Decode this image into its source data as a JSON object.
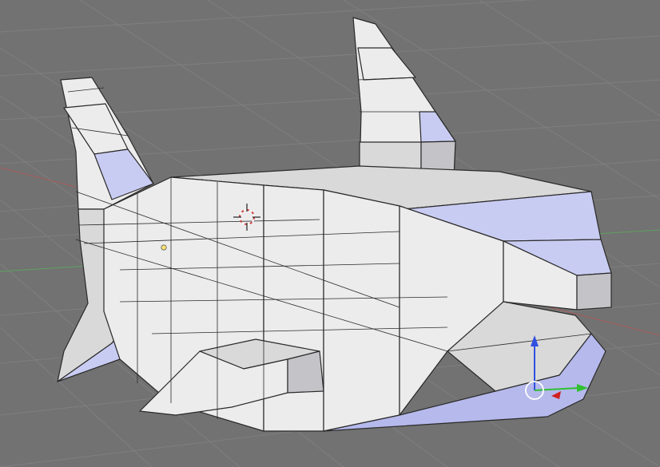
{
  "viewport": {
    "background": "#727272",
    "grid_color": "#7f7f7f",
    "x_axis_color": "#a85a5a",
    "y_axis_color": "#5fa05f"
  },
  "mesh": {
    "face_light": "#ececec",
    "face_mid": "#d9d9d9",
    "face_shade": "#c4c4c8",
    "face_blue": "#c9ccf2",
    "face_blue_deep": "#b5b9ec",
    "edge_color": "#2a2a2a"
  },
  "cursor_3d": {
    "ring_color": "#d04040",
    "cross_color": "#222222"
  },
  "manipulator": {
    "z_color": "#3050e0",
    "x_color": "#d02020",
    "y_color": "#30c030",
    "center_color": "#ffffff"
  },
  "origin_dot_color": "#f5e27a"
}
